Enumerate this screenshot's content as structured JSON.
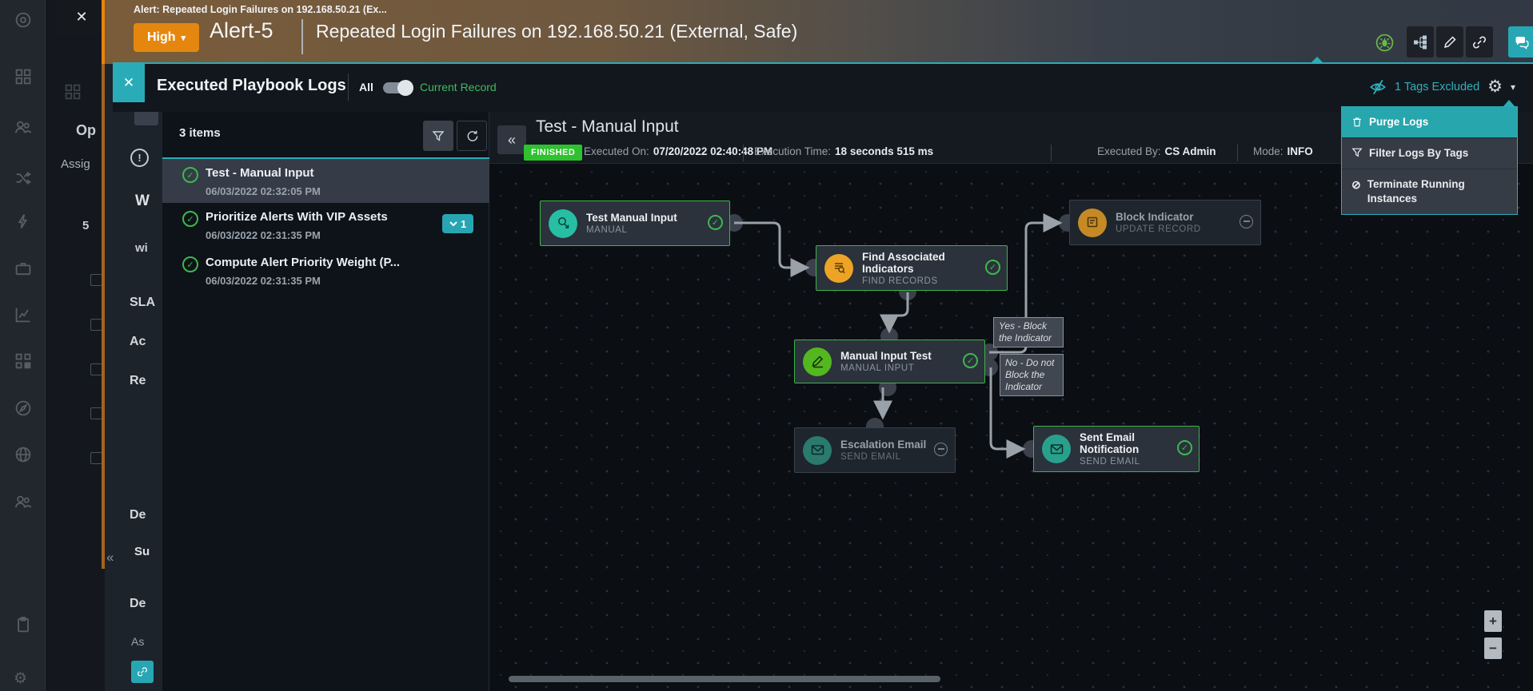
{
  "alert_header": {
    "tab_title": "Alert: Repeated Login Failures on 192.168.50.21 (Ex...",
    "severity": "High",
    "severity_caret": "▾",
    "record_id": "Alert-5",
    "title": "Repeated Login Failures on 192.168.50.21 (External, Safe)"
  },
  "playbook_panel": {
    "close_glyph": "✕",
    "title": "Executed Playbook Logs",
    "toggle_left_label": "All",
    "toggle_right_label": "Current Record",
    "tags_excluded_label": "1 Tags Excluded",
    "gear_glyph": "⚙",
    "caret_glyph": "▾"
  },
  "settings_menu": {
    "items": [
      {
        "label": "Purge Logs"
      },
      {
        "label": "Filter Logs By Tags"
      },
      {
        "label": "Terminate Running Instances"
      }
    ],
    "ban_glyph": "⊘"
  },
  "log_list": {
    "count": "3 items",
    "items": [
      {
        "title": "Test - Manual Input",
        "time": "06/03/2022 02:32:05 PM"
      },
      {
        "title": "Prioritize Alerts With VIP Assets",
        "time": "06/03/2022 02:31:35 PM",
        "badge": "1"
      },
      {
        "title": "Compute Alert Priority Weight (P...",
        "time": "06/03/2022 02:31:35 PM"
      }
    ],
    "check_glyph": "✓"
  },
  "execution": {
    "collapse_glyph": "«",
    "title": "Test - Manual Input",
    "status_badge": "FINISHED",
    "executed_on_label": "Executed On:",
    "executed_on_value": "07/20/2022 02:40:48 PM",
    "execution_time_label": "Execution Time:",
    "execution_time_value": "18 seconds 515 ms",
    "executed_by_label": "Executed By:",
    "executed_by_value": "CS Admin",
    "mode_label": "Mode:",
    "mode_value": "INFO"
  },
  "graph": {
    "nodes": [
      {
        "title": "Test Manual Input",
        "subtitle": "MANUAL"
      },
      {
        "title": "Find Associated Indicators",
        "subtitle": "FIND RECORDS"
      },
      {
        "title": "Block Indicator",
        "subtitle": "UPDATE RECORD"
      },
      {
        "title": "Manual Input Test",
        "subtitle": "MANUAL INPUT"
      },
      {
        "title": "Escalation Email",
        "subtitle": "SEND EMAIL"
      },
      {
        "title": "Sent Email Notification",
        "subtitle": "SEND EMAIL"
      }
    ],
    "edge_labels": [
      {
        "text": "Yes - Block the Indicator"
      },
      {
        "text": "No - Do not Block the Indicator"
      }
    ],
    "zoom_in_glyph": "+",
    "zoom_out_glyph": "−"
  },
  "background": {
    "close_glyph": "✕",
    "fragments": [
      {
        "text": "Op"
      },
      {
        "text": "Assig"
      },
      {
        "text": "5"
      },
      {
        "text": "«"
      },
      {
        "text": "W"
      },
      {
        "text": "wi"
      },
      {
        "text": "SLA"
      },
      {
        "text": "Ac"
      },
      {
        "text": "Re"
      },
      {
        "text": "De"
      },
      {
        "text": "Su"
      },
      {
        "text": "De"
      },
      {
        "text": "As"
      },
      {
        "text": "!"
      }
    ]
  },
  "colors": {
    "accent_teal": "#2aacb8",
    "severity_orange": "#e5870f",
    "success_green": "#3cb549",
    "finished_green": "#2ec22e"
  }
}
